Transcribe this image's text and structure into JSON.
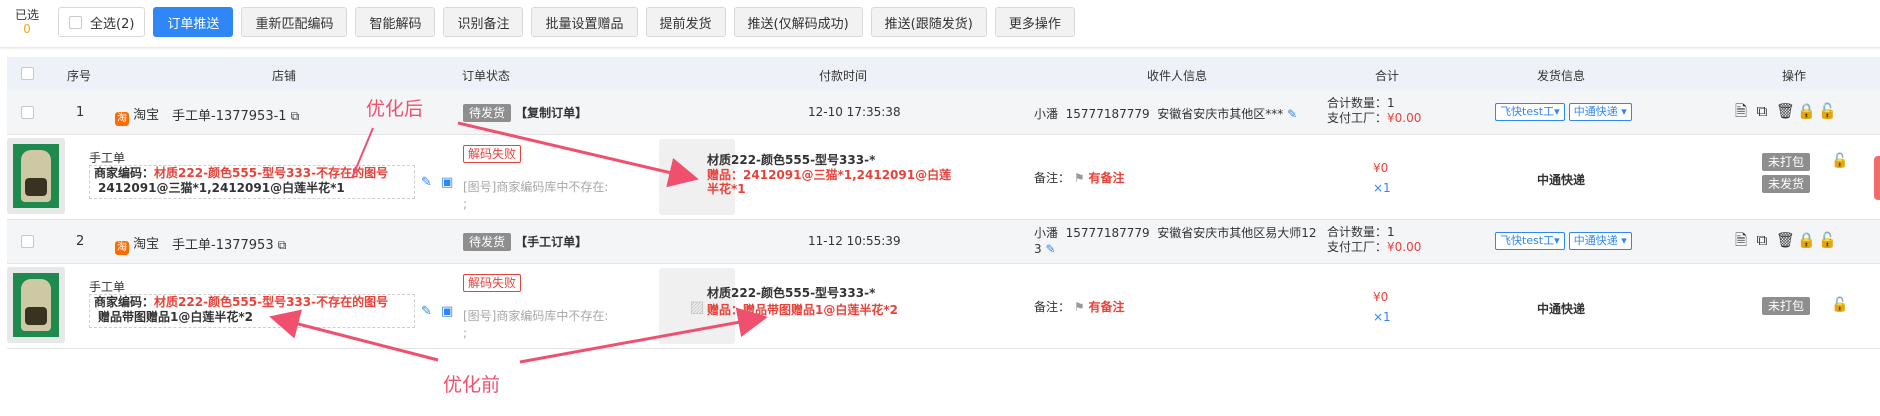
{
  "toolbar": {
    "selected_label": "已选",
    "selected_count": "0",
    "select_all": "全选(2)",
    "buttons": [
      "订单推送",
      "重新匹配编码",
      "智能解码",
      "识别备注",
      "批量设置赠品",
      "提前发货",
      "推送(仅解码成功)",
      "推送(跟随发货)",
      "更多操作"
    ]
  },
  "table": {
    "headers": {
      "index": "序号",
      "shop": "店铺",
      "status": "订单状态",
      "pay_time": "付款时间",
      "receiver": "收件人信息",
      "total": "合计",
      "ship": "发货信息",
      "ops": "操作"
    }
  },
  "orders": [
    {
      "index": "1",
      "shop_icon": "淘",
      "platform": "淘宝",
      "order_no": "手工单-1377953-1",
      "status": "待发货",
      "status_note": "【复制订单】",
      "pay_time": "12-10 17:35:38",
      "receiver_name": "小潘",
      "receiver_phone": "15777187779",
      "receiver_addr": "安徽省安庆市其他区***",
      "total_qty_label": "合计数量：",
      "total_qty": "1",
      "factory_label": "支付工厂：",
      "factory_amount": "¥0.00",
      "ship_pill_1": "飞快test工",
      "ship_pill_2": "中通快递",
      "goods": {
        "type": "手工单",
        "code_label": "商家编码：",
        "code_value": "材质222-颜色555-型号333-不存在的图号",
        "code_line2": "2412091@三猫*1,2412091@白莲半花*1",
        "decode_tag": "解码失败",
        "decode_msg": "[图号]商家编码库中不存在:",
        "decode_msg2": ";",
        "title": "材质222-颜色555-型号333-*",
        "gift_label": "赠品：",
        "gift_value": "2412091@三猫*1,2412091@白莲半花*1",
        "remark_label": "备注：",
        "remark_value": "有备注",
        "price": "¥0",
        "qty": "×1",
        "courier": "中通快递",
        "tag1": "未打包",
        "tag2": "未发货"
      }
    },
    {
      "index": "2",
      "shop_icon": "淘",
      "platform": "淘宝",
      "order_no": "手工单-1377953",
      "status": "待发货",
      "status_note": "【手工订单】",
      "pay_time": "11-12 10:55:39",
      "receiver_name": "小潘",
      "receiver_phone": "15777187779",
      "receiver_addr": "安徽省安庆市其他区易大师12",
      "receiver_addr2": "3",
      "total_qty_label": "合计数量：",
      "total_qty": "1",
      "factory_label": "支付工厂：",
      "factory_amount": "¥0.00",
      "ship_pill_1": "飞快test工",
      "ship_pill_2": "中通快递",
      "goods": {
        "type": "手工单",
        "code_label": "商家编码：",
        "code_value": "材质222-颜色555-型号333-不存在的图号",
        "code_line2": "赠品带图赠品1@白莲半花*2",
        "decode_tag": "解码失败",
        "decode_msg": "[图号]商家编码库中不存在:",
        "decode_msg2": ";",
        "title": "材质222-颜色555-型号333-*",
        "gift_label": "赠品：",
        "gift_value": "赠品带图赠品1@白莲半花*2",
        "remark_label": "备注：",
        "remark_value": "有备注",
        "price": "¥0",
        "qty": "×1",
        "courier": "中通快递",
        "tag1": "未打包"
      }
    }
  ],
  "annotations": {
    "after": "优化后",
    "before": "优化前"
  },
  "colors": {
    "primary": "#2f86f6",
    "danger": "#e8423a",
    "annotation": "#f0506e"
  }
}
